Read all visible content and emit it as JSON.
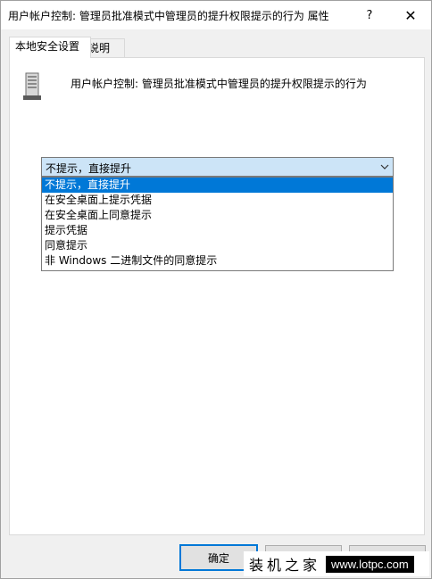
{
  "window": {
    "title": "用户帐户控制: 管理员批准模式中管理员的提升权限提示的行为 属性",
    "help_label": "?",
    "close_label": "✕"
  },
  "tabs": [
    {
      "label": "本地安全设置",
      "active": true
    },
    {
      "label": "说明",
      "active": false
    }
  ],
  "policy": {
    "icon": "server-policy-icon",
    "title": "用户帐户控制: 管理员批准模式中管理员的提升权限提示的行为"
  },
  "combo": {
    "selected_value": "不提示，直接提升",
    "options": [
      "不提示，直接提升",
      "在安全桌面上提示凭据",
      "在安全桌面上同意提示",
      "提示凭据",
      "同意提示",
      "非 Windows 二进制文件的同意提示"
    ],
    "highlighted_index": 0
  },
  "buttons": {
    "ok_label": "确定"
  },
  "watermark": {
    "text": "装机之家",
    "url": "www.lotpc.com"
  },
  "colors": {
    "accent": "#0078d7",
    "combo_bg": "#cce4f7"
  }
}
